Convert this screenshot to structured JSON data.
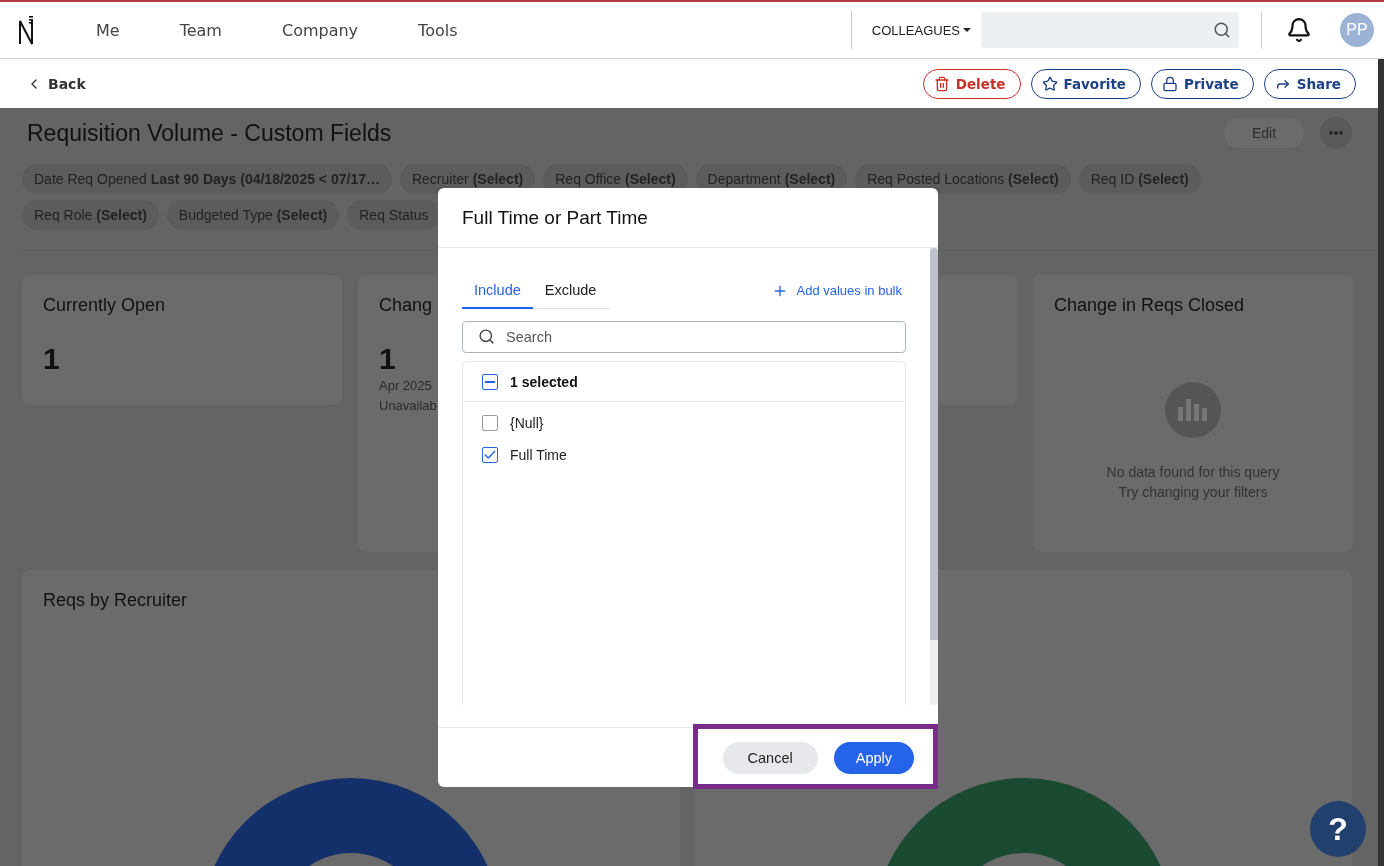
{
  "nav": {
    "items": [
      "Me",
      "Team",
      "Company",
      "Tools"
    ],
    "scope": "COLLEAGUES",
    "avatar": "PP"
  },
  "toolbar": {
    "back": "Back",
    "actions": [
      {
        "kind": "delete",
        "label": "Delete"
      },
      {
        "kind": "favorite",
        "label": "Favorite"
      },
      {
        "kind": "private",
        "label": "Private"
      },
      {
        "kind": "share",
        "label": "Share"
      }
    ]
  },
  "report": {
    "title": "Requisition Volume - Custom Fields",
    "edit": {
      "label": "Edit",
      "disabled": true
    },
    "filters": [
      [
        {
          "label": "Date Req Opened",
          "value": "Last 90 Days (04/18/2025 < 07/17…"
        },
        {
          "label": "Recruiter",
          "value": "(Select)"
        },
        {
          "label": "Req Office",
          "value": "(Select)"
        },
        {
          "label": "Department",
          "value": "(Select)"
        },
        {
          "label": "Req Posted Locations",
          "value": "(Select)"
        },
        {
          "label": "Req ID",
          "value": "(Select)"
        }
      ],
      [
        {
          "label": "Req Role",
          "value": "(Select)"
        },
        {
          "label": "Budgeted Type",
          "value": "(Select)"
        },
        {
          "label": "Req Status"
        }
      ]
    ],
    "cards": [
      {
        "kind": "metric",
        "title": "Currently Open",
        "value": "1"
      },
      {
        "kind": "metric",
        "title": "Chang",
        "value": "1",
        "notes": [
          "Apr 2025",
          "Unavailab"
        ]
      },
      {
        "kind": "blank"
      },
      {
        "kind": "empty",
        "title": "Change in Reqs Closed",
        "notes": [
          "No data found for this query",
          "Try changing your filters"
        ]
      }
    ],
    "charts": [
      {
        "title": "Reqs by Recruiter",
        "color": "#13306b"
      },
      {
        "color": "#1b4a32"
      }
    ]
  },
  "dialog": {
    "title": "Full Time or Part Time",
    "tabs": [
      {
        "label": "Include",
        "selected": true
      },
      {
        "label": "Exclude",
        "selected": false
      }
    ],
    "bulk": "Add values in bulk",
    "placeholder": "Search",
    "summary": {
      "label": "1 selected",
      "indeterminate": true
    },
    "options": [
      {
        "label": "{Null}",
        "checked": false
      },
      {
        "label": "Full Time",
        "checked": true
      }
    ],
    "buttons": [
      {
        "kind": "cancel",
        "label": "Cancel"
      },
      {
        "kind": "apply",
        "label": "Apply"
      }
    ]
  },
  "help": "?"
}
